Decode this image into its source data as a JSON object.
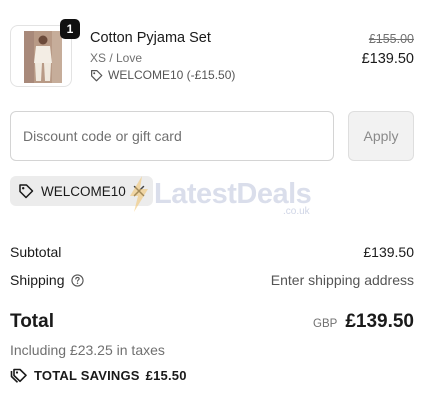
{
  "line_item": {
    "quantity": "1",
    "name": "Cotton Pyjama Set",
    "variant": "XS / Love",
    "discount_label": "WELCOME10 (-£15.50)",
    "original_price": "£155.00",
    "price": "£139.50"
  },
  "discount": {
    "placeholder": "Discount code or gift card",
    "value": "",
    "apply_label": "Apply",
    "applied_code": "WELCOME10"
  },
  "watermark": {
    "name": "LatestDeals",
    "sub": ".co.uk"
  },
  "summary": {
    "subtotal_label": "Subtotal",
    "subtotal_value": "£139.50",
    "shipping_label": "Shipping",
    "shipping_value": "Enter shipping address",
    "total_label": "Total",
    "currency": "GBP",
    "total_value": "£139.50",
    "taxes_note": "Including £23.25 in taxes",
    "savings_label": "TOTAL SAVINGS",
    "savings_value": "£15.50"
  },
  "colors": {
    "text": "#1a1a1a",
    "muted": "#707070",
    "badge": "#111111",
    "chip": "#ececec",
    "watermark": "#bcc4dc"
  },
  "icons": [
    "product-thumbnail",
    "tag-icon",
    "close-icon",
    "lightning-icon",
    "question-circle-icon",
    "tags-icon"
  ]
}
